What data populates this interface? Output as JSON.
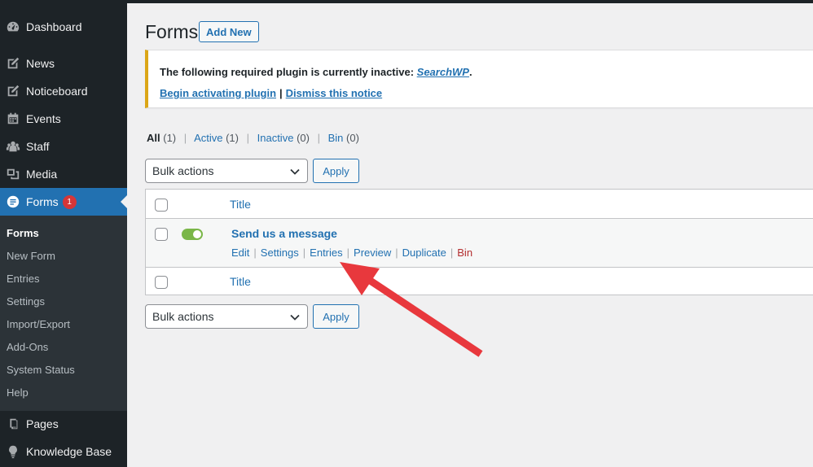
{
  "sidebar": {
    "items": [
      {
        "label": "Dashboard",
        "icon": "dashboard-icon"
      },
      {
        "label": "News",
        "icon": "post-icon"
      },
      {
        "label": "Noticeboard",
        "icon": "post-icon"
      },
      {
        "label": "Events",
        "icon": "calendar-icon"
      },
      {
        "label": "Staff",
        "icon": "groups-icon"
      },
      {
        "label": "Media",
        "icon": "media-icon"
      },
      {
        "label": "Forms",
        "icon": "forms-icon",
        "badge": "1"
      },
      {
        "label": "Pages",
        "icon": "page-icon"
      },
      {
        "label": "Knowledge Base",
        "icon": "lightbulb-icon"
      }
    ],
    "submenu": [
      "Forms",
      "New Form",
      "Entries",
      "Settings",
      "Import/Export",
      "Add-Ons",
      "System Status",
      "Help"
    ]
  },
  "header": {
    "title": "Forms",
    "add_new": "Add New"
  },
  "notice": {
    "text_prefix": "The following required plugin is currently inactive: ",
    "plugin_name": "SearchWP",
    "text_suffix": ".",
    "activate_link": "Begin activating plugin",
    "separator": "|",
    "dismiss_link": "Dismiss this notice"
  },
  "filters": [
    {
      "label": "All",
      "count": "(1)"
    },
    {
      "label": "Active",
      "count": "(1)"
    },
    {
      "label": "Inactive",
      "count": "(0)"
    },
    {
      "label": "Bin",
      "count": "(0)"
    }
  ],
  "bulk": {
    "select_value": "Bulk actions",
    "apply": "Apply"
  },
  "table": {
    "column_title": "Title",
    "row": {
      "title": "Send us a message",
      "active": true,
      "actions": [
        "Edit",
        "Settings",
        "Entries",
        "Preview",
        "Duplicate",
        "Bin"
      ]
    }
  },
  "colors": {
    "accent": "#2271b1",
    "sidebar": "#1d2327",
    "notice_border": "#dba617",
    "toggle_on": "#7ab648",
    "annotation_arrow": "#e8383d",
    "danger": "#b32d2e"
  }
}
